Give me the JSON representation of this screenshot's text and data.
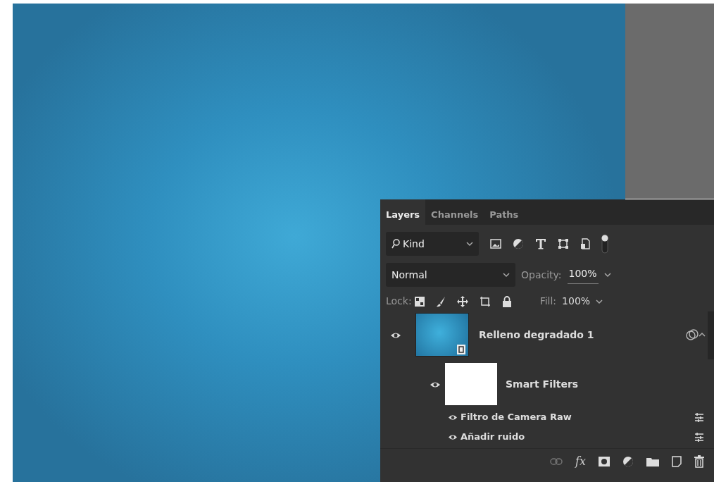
{
  "tabs": [
    {
      "label": "Layers",
      "selected": true
    },
    {
      "label": "Channels",
      "selected": false
    },
    {
      "label": "Paths",
      "selected": false
    }
  ],
  "filter": {
    "value": "Kind",
    "toggle_on": true
  },
  "blend_mode": {
    "value": "Normal"
  },
  "opacity": {
    "label": "Opacity:",
    "value": "100%"
  },
  "lock": {
    "label": "Lock:"
  },
  "fill": {
    "label": "Fill:",
    "value": "100%"
  },
  "layer": {
    "name": "Relleno degradado 1",
    "visible": true,
    "smart_filters": {
      "name": "Smart Filters",
      "visible": true
    },
    "filters": [
      {
        "name": "Filtro de Camera Raw",
        "visible": true
      },
      {
        "name": "Añadir ruido",
        "visible": true
      }
    ]
  },
  "footer": {
    "fx": "fx"
  }
}
